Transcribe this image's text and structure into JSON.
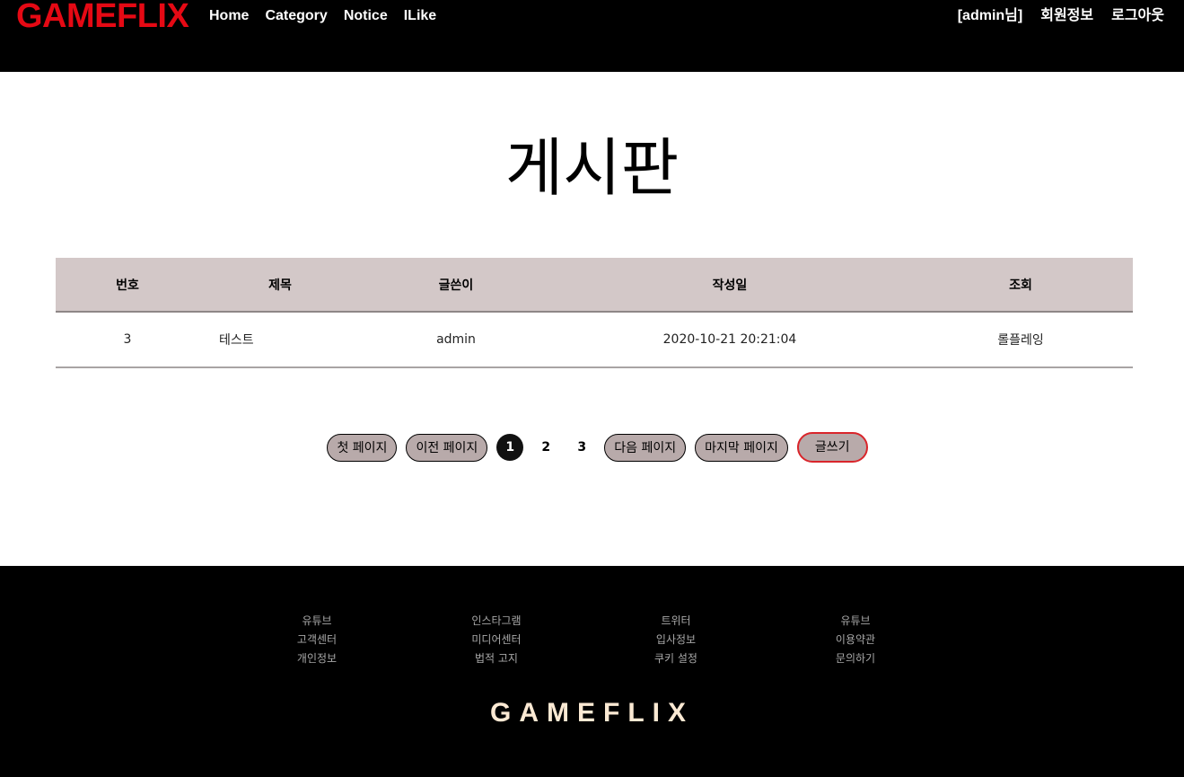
{
  "header": {
    "logo": "GAMEFLIX",
    "nav": [
      "Home",
      "Category",
      "Notice",
      "ILike"
    ],
    "user": "[admin님]",
    "member_info": "회원정보",
    "logout": "로그아웃"
  },
  "page_title": "게시판",
  "table": {
    "columns": [
      "번호",
      "제목",
      "글쓴이",
      "작성일",
      "조회"
    ],
    "rows": [
      [
        "3",
        "테스트",
        "admin",
        "2020-10-21 20:21:04",
        "롤플레잉"
      ]
    ]
  },
  "pagination": {
    "first": "첫 페이지",
    "prev": "이전 페이지",
    "pages": [
      "1",
      "2",
      "3"
    ],
    "current_page": "1",
    "next": "다음 페이지",
    "last": "마지막 페이지",
    "write": "글쓰기"
  },
  "footer": {
    "columns": [
      [
        "유튜브",
        "고객센터",
        "개인정보"
      ],
      [
        "인스타그램",
        "미디어센터",
        "법적 고지"
      ],
      [
        "트위터",
        "입사정보",
        "쿠키 설정"
      ],
      [
        "유튜브",
        "이용약관",
        "문의하기"
      ]
    ],
    "brand": "GAMEFLIX"
  },
  "colors": {
    "logo": "#e50914",
    "header_bg": "#000000",
    "table_head_bg": "#d3c8c8",
    "pill_bg": "#b8aaaa",
    "write_border": "#d9252b",
    "footer_brand": "#fbe9d3"
  }
}
